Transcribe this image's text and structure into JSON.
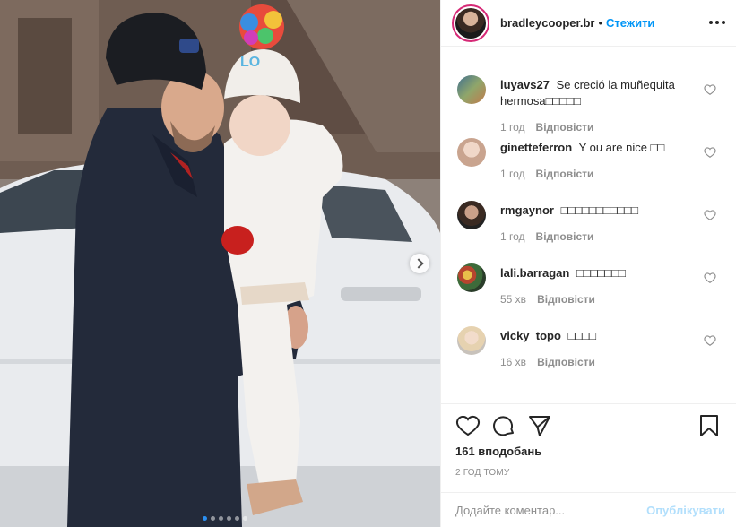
{
  "post": {
    "image_alt": "",
    "carousel_dots": 6,
    "carousel_active": 0
  },
  "header": {
    "username": "bradleycooper.br",
    "separator": "•",
    "follow_label": "Стежити"
  },
  "comments": [
    {
      "username": "luyavs27",
      "text": "Se creció la muñequita hermosa□□□□□",
      "time": "1 год",
      "reply_label": "Відповісти",
      "avatar_color": "#5b6a7a"
    },
    {
      "username": "ginetteferron",
      "text": "Y ou are nice □□",
      "time": "1 год",
      "reply_label": "Відповісти",
      "avatar_color": "#c9a48f"
    },
    {
      "username": "rmgaynor",
      "text": "□□□□□□□□□□□",
      "time": "1 год",
      "reply_label": "Відповісти",
      "avatar_color": "#6e5647"
    },
    {
      "username": "lali.barragan",
      "text": "□□□□□□□",
      "time": "55 хв",
      "reply_label": "Відповісти",
      "avatar_color": "#8a6a3c"
    },
    {
      "username": "vicky_topo",
      "text": "□□□□",
      "time": "16 хв",
      "reply_label": "Відповісти",
      "avatar_color": "#d9c9b8"
    }
  ],
  "actions": {
    "likes_text": "161 вподобань",
    "time_ago": "2 год тому",
    "comment_placeholder": "Додайте коментар...",
    "post_label": "Опублікувати"
  },
  "colors": {
    "link": "#0095f6",
    "post_disabled": "#b2dffc",
    "carousel_active": "#2b8ff1"
  }
}
